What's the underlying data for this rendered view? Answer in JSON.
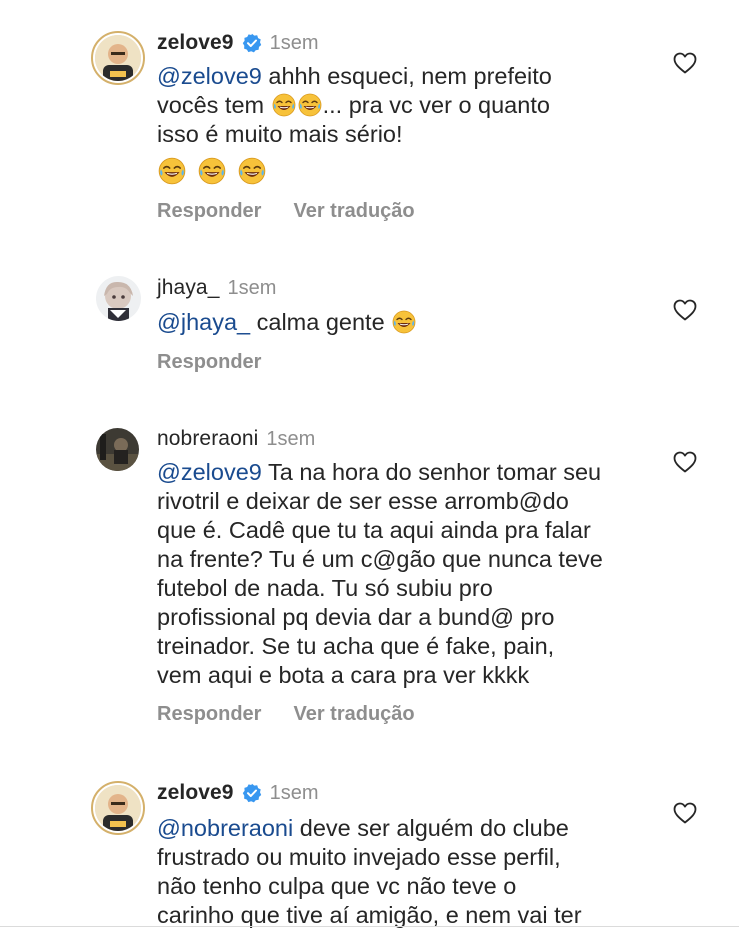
{
  "comments": [
    {
      "username": "zelove9",
      "time": "1sem",
      "mention": "@zelove9",
      "lines": [
        " ahhh esqueci, nem prefeito",
        "vocês tem ",
        "... pra vc ver o quanto",
        "isso é muito mais sério!"
      ],
      "actions": {
        "reply": "Responder",
        "translate": "Ver tradução"
      }
    },
    {
      "username": "jhaya_",
      "time": "1sem",
      "mention": "@jhaya_",
      "text": " calma gente ",
      "actions": {
        "reply": "Responder"
      }
    },
    {
      "username": "nobreraoni",
      "time": "1sem",
      "mention": "@zelove9",
      "lines": [
        " Ta na hora do senhor tomar seu",
        "rivotril e deixar de ser esse arromb@do",
        "que é. Cadê que tu ta aqui ainda pra falar",
        "na frente? Tu é um c@gão que nunca teve",
        "futebol de nada. Tu só subiu pro",
        "profissional pq devia dar a bund@ pro",
        "treinador. Se tu acha que é fake, pain,",
        "vem aqui e bota a cara pra ver kkkk"
      ],
      "actions": {
        "reply": "Responder",
        "translate": "Ver tradução"
      }
    },
    {
      "username": "zelove9",
      "time": "1sem",
      "mention": "@nobreraoni",
      "lines": [
        " deve ser alguém do clube",
        "frustrado ou muito invejado esse perfil,",
        "não tenho culpa que vc não teve o",
        "carinho que tive aí amigão, e nem vai ter"
      ]
    }
  ],
  "icons": {
    "verified": "verified-badge-icon",
    "heart": "heart-outline-icon",
    "emoji": "face-with-tears-of-joy-icon"
  },
  "colors": {
    "mention": "#1a4b8f",
    "verified": "#3897f0",
    "secondary_text": "#8e8e8e"
  }
}
